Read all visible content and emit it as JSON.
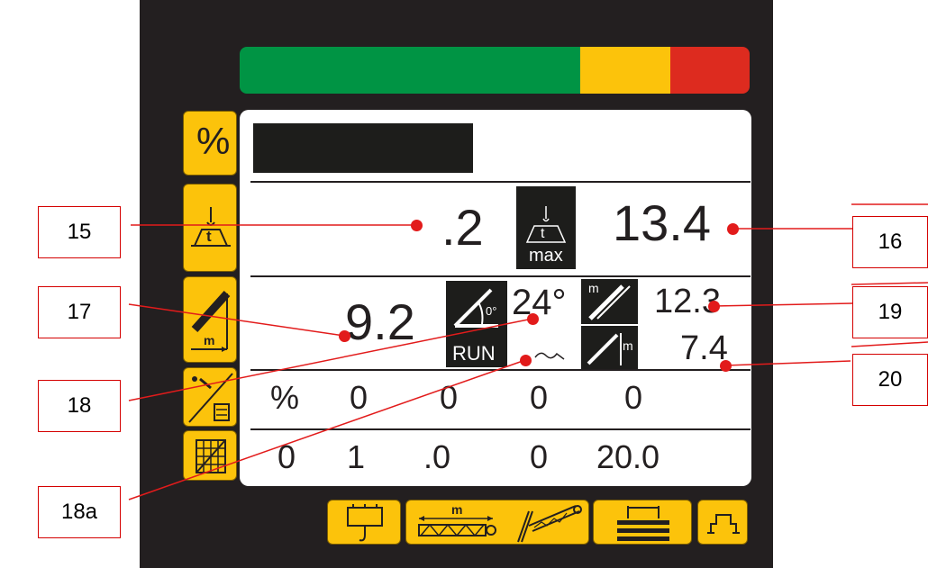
{
  "load_bar": {
    "colors": {
      "green": "#009444",
      "yellow": "#fcc30b",
      "red": "#dd2b1f"
    }
  },
  "sidebar": {
    "items": [
      {
        "icon": "percent-icon",
        "label": "%"
      },
      {
        "icon": "load-tons-icon",
        "label": "t"
      },
      {
        "icon": "boom-radius-icon",
        "label": "m"
      },
      {
        "icon": "counterweight-icon"
      },
      {
        "icon": "grid-icon"
      }
    ]
  },
  "display": {
    "load": ".2",
    "max_icon_label": "max",
    "max_icon_unit": "t",
    "max_load": "13.4",
    "radius": "9.2",
    "angle_icon_label": "0°",
    "run_label": "RUN",
    "angle": "24°",
    "boom_length": "12.3",
    "boom_length_unit": "m",
    "height": "7.4",
    "height_unit": "m",
    "row1": [
      "%",
      "0",
      "0",
      "0",
      "0"
    ],
    "row2": [
      "0",
      "1",
      ".0",
      "0",
      "20.0"
    ]
  },
  "callouts": [
    "15",
    "16",
    "17",
    "18",
    "18a",
    "19",
    "20"
  ],
  "bottom_buttons": [
    {
      "icon": "hook-icon"
    },
    {
      "icon": "boom-extension-icon",
      "label": "m"
    },
    {
      "icon": "luffing-jib-icon"
    },
    {
      "icon": "counterweight-stack-icon"
    },
    {
      "icon": "outrigger-icon"
    }
  ],
  "accent_color": "#e21b1b"
}
